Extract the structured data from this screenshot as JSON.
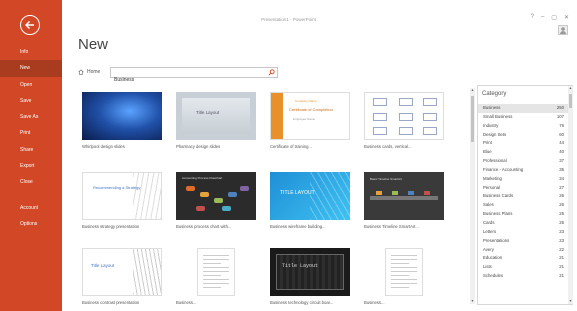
{
  "window": {
    "title": "Presentation1 - PowerPoint",
    "controls": [
      "?",
      "–",
      "▢",
      "✕"
    ]
  },
  "sidebar": {
    "items": [
      {
        "label": "Info"
      },
      {
        "label": "New"
      },
      {
        "label": "Open"
      },
      {
        "label": "Save"
      },
      {
        "label": "Save As"
      },
      {
        "label": "Print"
      },
      {
        "label": "Share"
      },
      {
        "label": "Export"
      },
      {
        "label": "Close"
      },
      {
        "label": "Account"
      },
      {
        "label": "Options"
      }
    ],
    "active_index": 1,
    "accent_color": "#d24726"
  },
  "main": {
    "title": "New",
    "home_label": "Home",
    "search": {
      "value": "Business",
      "placeholder": ""
    },
    "templates": [
      {
        "label": "Whirlpool design slides",
        "design": "whirl"
      },
      {
        "label": "Pharmacy design slides",
        "design": "pharm",
        "thumb_text": "Title Layout"
      },
      {
        "label": "Certificate of training...",
        "design": "cert",
        "thumb_text": [
          "Company Name",
          "Certificate of Completion",
          "Employee Name"
        ]
      },
      {
        "label": "Business cards, vertical...",
        "design": "cards"
      },
      {
        "label": "Business strategy presentation",
        "design": "strat",
        "thumb_text": "Recommending a Strategy"
      },
      {
        "label": "Business process chart with...",
        "design": "proc",
        "thumb_text": "Accounting Process Flowchart"
      },
      {
        "label": "Business wireframe building...",
        "design": "wire",
        "thumb_text": "TITLE LAYOUT"
      },
      {
        "label": "Business Timeline SmartArt...",
        "design": "timeline",
        "thumb_text": "Basic Timeline SmartArt"
      },
      {
        "label": "Business contrast presentation",
        "design": "contrast",
        "thumb_text": "Title Layout"
      },
      {
        "label": "Business...",
        "design": "doc"
      },
      {
        "label": "Business technology circuit boar...",
        "design": "circuit",
        "thumb_text": "Title Layout"
      },
      {
        "label": "Business...",
        "design": "doc"
      }
    ]
  },
  "category": {
    "title": "Category",
    "items": [
      {
        "name": "Business",
        "count": "250"
      },
      {
        "name": "Small Business",
        "count": "107"
      },
      {
        "name": "Industry",
        "count": "76"
      },
      {
        "name": "Design Sets",
        "count": "60"
      },
      {
        "name": "Print",
        "count": "44"
      },
      {
        "name": "Blue",
        "count": "40"
      },
      {
        "name": "Professional",
        "count": "37"
      },
      {
        "name": "Finance - Accounting",
        "count": "35"
      },
      {
        "name": "Marketing",
        "count": "34"
      },
      {
        "name": "Personal",
        "count": "27"
      },
      {
        "name": "Business Cards",
        "count": "26"
      },
      {
        "name": "Sales",
        "count": "26"
      },
      {
        "name": "Business Plans",
        "count": "25"
      },
      {
        "name": "Cards",
        "count": "25"
      },
      {
        "name": "Letters",
        "count": "23"
      },
      {
        "name": "Presentations",
        "count": "23"
      },
      {
        "name": "Avery",
        "count": "22"
      },
      {
        "name": "Education",
        "count": "21"
      },
      {
        "name": "Lists",
        "count": "21"
      },
      {
        "name": "Schedules",
        "count": "21"
      }
    ],
    "selected_index": 0
  }
}
